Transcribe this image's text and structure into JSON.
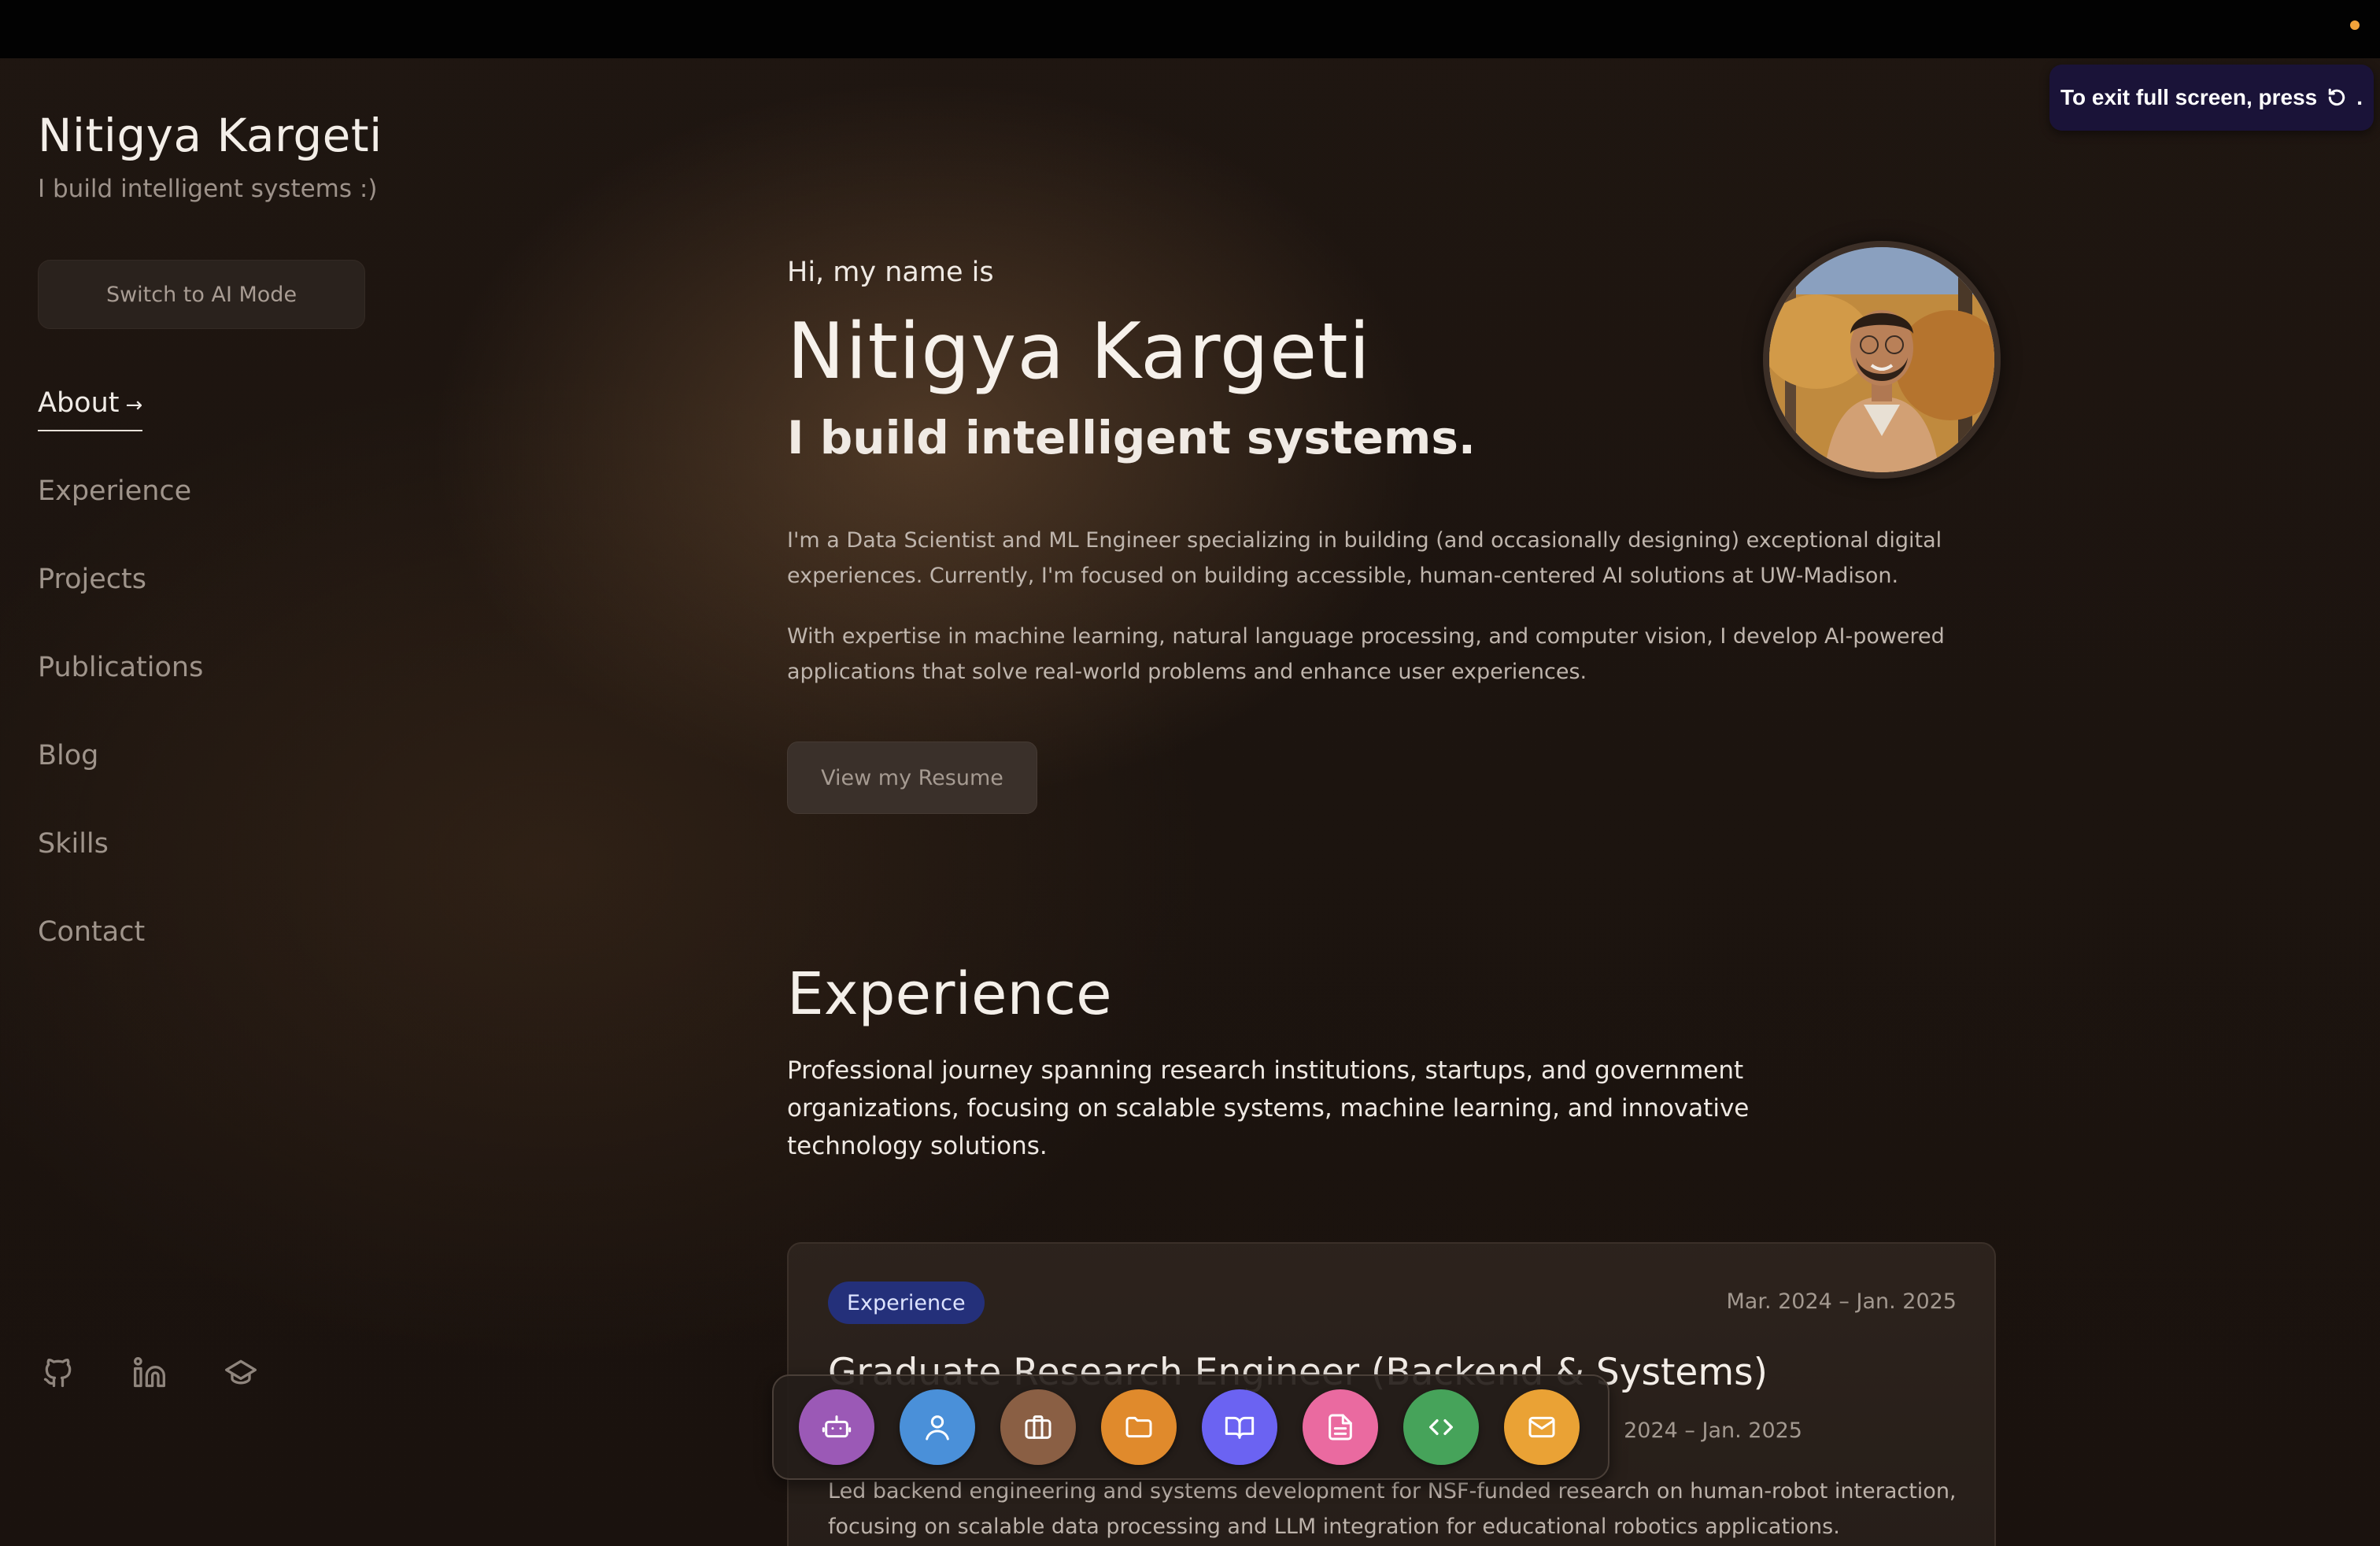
{
  "browser": {
    "fullscreen_notice": "To exit full screen, press",
    "fullscreen_key_icon": "escape-key-icon",
    "indicator_color": "#f2a33a"
  },
  "sidebar": {
    "name": "Nitigya Kargeti",
    "tagline": "I build intelligent systems :)",
    "ai_mode_button": "Switch to AI Mode",
    "nav": [
      {
        "label": "About",
        "active": true,
        "arrow": "→"
      },
      {
        "label": "Experience"
      },
      {
        "label": "Projects"
      },
      {
        "label": "Publications"
      },
      {
        "label": "Blog"
      },
      {
        "label": "Skills"
      },
      {
        "label": "Contact"
      }
    ],
    "social": [
      {
        "icon": "github-icon"
      },
      {
        "icon": "linkedin-icon"
      },
      {
        "icon": "scholar-icon"
      }
    ]
  },
  "hero": {
    "greeting": "Hi, my name is",
    "name": "Nitigya Kargeti",
    "tagline": "I build intelligent systems.",
    "bio_1": "I'm a Data Scientist and ML Engineer specializing in building (and occasionally designing) exceptional digital experiences. Currently, I'm focused on building accessible, human-centered AI solutions at UW-Madison.",
    "bio_2": "With expertise in machine learning, natural language processing, and computer vision, I develop AI-powered applications that solve real-world problems and enhance user experiences.",
    "resume_button": "View my Resume"
  },
  "experience": {
    "title": "Experience",
    "description": "Professional journey spanning research institutions, startups, and government organizations, focusing on scalable systems, machine learning, and innovative technology solutions.",
    "card": {
      "badge": "Experience",
      "date_range": "Mar. 2024 – Jan. 2025",
      "role": "Graduate Research Engineer (Backend & Systems)",
      "date_range_secondary": "2024 – Jan. 2025",
      "summary": "Led backend engineering and systems development for NSF-funded research on human-robot interaction, focusing on scalable data processing and LLM integration for educational robotics applications."
    }
  },
  "dock": [
    {
      "icon": "robot-icon",
      "color": "#9b59b6"
    },
    {
      "icon": "user-icon",
      "color": "#4a90d9"
    },
    {
      "icon": "briefcase-icon",
      "color": "#8a5f44"
    },
    {
      "icon": "folder-icon",
      "color": "#e08a2c"
    },
    {
      "icon": "book-icon",
      "color": "#6b63f2"
    },
    {
      "icon": "document-icon",
      "color": "#ea6aa0"
    },
    {
      "icon": "code-icon",
      "color": "#46a35a"
    },
    {
      "icon": "mail-icon",
      "color": "#eaa235"
    }
  ]
}
